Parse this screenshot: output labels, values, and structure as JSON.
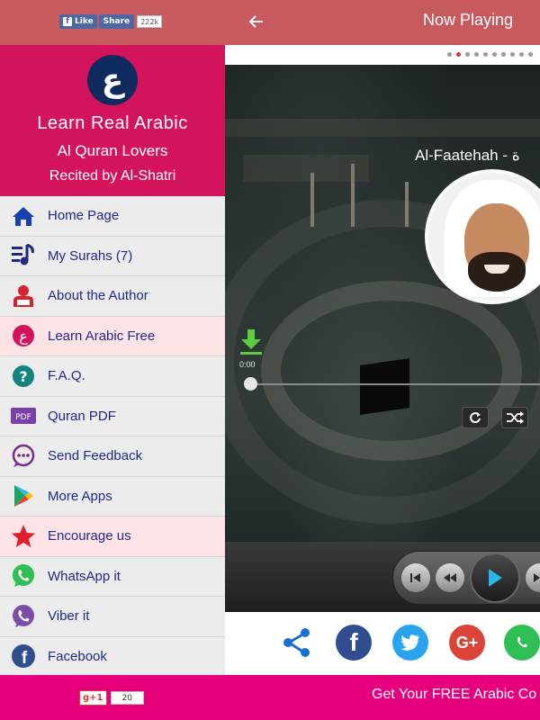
{
  "topbar": {
    "fb_like_label": "Like",
    "fb_share_label": "Share",
    "fb_count": "222k",
    "back_icon": "back-arrow-icon",
    "title": "Now Playing",
    "background": "#c75a5f"
  },
  "drawer": {
    "logo_glyph": "ع",
    "app_name": "Learn Real Arabic",
    "subtitle1": "Al Quran Lovers",
    "subtitle2": "Recited by Al-Shatri",
    "header_color": "#d3135c",
    "items": [
      {
        "label": "Home Page",
        "icon": "home-icon",
        "highlight": false
      },
      {
        "label": "My Surahs (7)",
        "icon": "music-list-icon",
        "highlight": false
      },
      {
        "label": "About the Author",
        "icon": "author-icon",
        "highlight": false
      },
      {
        "label": "Learn Arabic Free",
        "icon": "arabic-logo-icon",
        "highlight": true
      },
      {
        "label": "F.A.Q.",
        "icon": "question-icon",
        "highlight": false
      },
      {
        "label": "Quran PDF",
        "icon": "pdf-icon",
        "highlight": false
      },
      {
        "label": "Send Feedback",
        "icon": "feedback-icon",
        "highlight": false
      },
      {
        "label": "More Apps",
        "icon": "play-store-icon",
        "highlight": false
      },
      {
        "label": "Encourage us",
        "icon": "star-icon",
        "highlight": true
      },
      {
        "label": "WhatsApp it",
        "icon": "whatsapp-icon",
        "highlight": false
      },
      {
        "label": "Viber it",
        "icon": "viber-icon",
        "highlight": false
      },
      {
        "label": "Facebook",
        "icon": "facebook-icon",
        "highlight": false
      }
    ]
  },
  "player": {
    "surah_title": "Al-Faatehah - ة",
    "current_time": "0:00",
    "progress": 0,
    "pager_dots": 10,
    "pager_active": 2,
    "repeat_icon": "repeat-icon",
    "shuffle_icon": "shuffle-icon"
  },
  "share": {
    "items": [
      "share-icon",
      "facebook-icon",
      "twitter-icon",
      "google-plus-icon",
      "whatsapp-icon"
    ],
    "gplus_label": "G+"
  },
  "bottom": {
    "gplus_label": "g+1",
    "gplus_count": "20",
    "promo": "Get Your FREE Arabic Co",
    "background": "#e6007e"
  }
}
